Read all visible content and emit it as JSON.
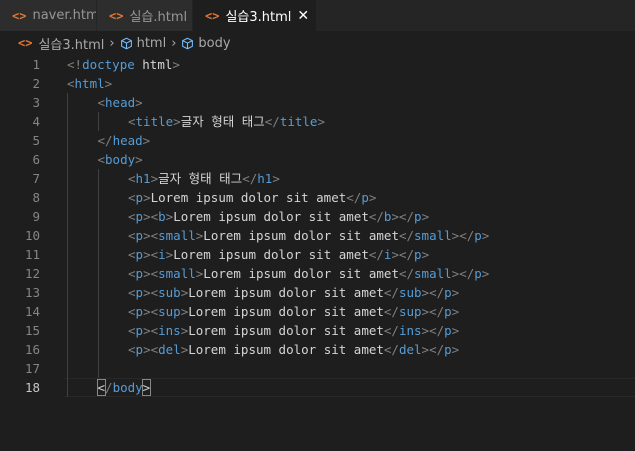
{
  "tabs": [
    {
      "icon": "<>",
      "label": "naver.html",
      "modified": true,
      "active": false
    },
    {
      "icon": "<>",
      "label": "실습.html",
      "modified": false,
      "active": false
    },
    {
      "icon": "<>",
      "label": "실습3.html",
      "modified": false,
      "active": true
    }
  ],
  "breadcrumb": {
    "file": "실습3.html",
    "items": [
      "html",
      "body"
    ]
  },
  "editor": {
    "current_line": 18,
    "lines": [
      {
        "n": "1",
        "indent": 0,
        "tokens": [
          [
            "p",
            "<!"
          ],
          [
            "t",
            "doctype"
          ],
          [
            "tx",
            " "
          ],
          [
            "tx",
            "html"
          ],
          [
            "p",
            ">"
          ]
        ]
      },
      {
        "n": "2",
        "indent": 0,
        "tokens": [
          [
            "p",
            "<"
          ],
          [
            "t",
            "html"
          ],
          [
            "p",
            ">"
          ]
        ]
      },
      {
        "n": "3",
        "indent": 1,
        "tokens": [
          [
            "p",
            "<"
          ],
          [
            "t",
            "head"
          ],
          [
            "p",
            ">"
          ]
        ]
      },
      {
        "n": "4",
        "indent": 2,
        "tokens": [
          [
            "p",
            "<"
          ],
          [
            "t",
            "title"
          ],
          [
            "p",
            ">"
          ],
          [
            "tx",
            "글자 형태 태그"
          ],
          [
            "p",
            "</"
          ],
          [
            "t",
            "title"
          ],
          [
            "p",
            ">"
          ]
        ]
      },
      {
        "n": "5",
        "indent": 1,
        "tokens": [
          [
            "p",
            "</"
          ],
          [
            "t",
            "head"
          ],
          [
            "p",
            ">"
          ]
        ]
      },
      {
        "n": "6",
        "indent": 1,
        "tokens": [
          [
            "p",
            "<"
          ],
          [
            "t",
            "body"
          ],
          [
            "p",
            ">"
          ]
        ]
      },
      {
        "n": "7",
        "indent": 2,
        "tokens": [
          [
            "p",
            "<"
          ],
          [
            "t",
            "h1"
          ],
          [
            "p",
            ">"
          ],
          [
            "tx",
            "글자 형태 태그"
          ],
          [
            "p",
            "</"
          ],
          [
            "t",
            "h1"
          ],
          [
            "p",
            ">"
          ]
        ]
      },
      {
        "n": "8",
        "indent": 2,
        "tokens": [
          [
            "p",
            "<"
          ],
          [
            "t",
            "p"
          ],
          [
            "p",
            ">"
          ],
          [
            "tx",
            "Lorem ipsum dolor sit amet"
          ],
          [
            "p",
            "</"
          ],
          [
            "t",
            "p"
          ],
          [
            "p",
            ">"
          ]
        ]
      },
      {
        "n": "9",
        "indent": 2,
        "tokens": [
          [
            "p",
            "<"
          ],
          [
            "t",
            "p"
          ],
          [
            "p",
            "><"
          ],
          [
            "t",
            "b"
          ],
          [
            "p",
            ">"
          ],
          [
            "tx",
            "Lorem ipsum dolor sit amet"
          ],
          [
            "p",
            "</"
          ],
          [
            "t",
            "b"
          ],
          [
            "p",
            "></"
          ],
          [
            "t",
            "p"
          ],
          [
            "p",
            ">"
          ]
        ]
      },
      {
        "n": "10",
        "indent": 2,
        "tokens": [
          [
            "p",
            "<"
          ],
          [
            "t",
            "p"
          ],
          [
            "p",
            "><"
          ],
          [
            "t",
            "small"
          ],
          [
            "p",
            ">"
          ],
          [
            "tx",
            "Lorem ipsum dolor sit amet"
          ],
          [
            "p",
            "</"
          ],
          [
            "t",
            "small"
          ],
          [
            "p",
            "></"
          ],
          [
            "t",
            "p"
          ],
          [
            "p",
            ">"
          ]
        ]
      },
      {
        "n": "11",
        "indent": 2,
        "tokens": [
          [
            "p",
            "<"
          ],
          [
            "t",
            "p"
          ],
          [
            "p",
            "><"
          ],
          [
            "t",
            "i"
          ],
          [
            "p",
            ">"
          ],
          [
            "tx",
            "Lorem ipsum dolor sit amet"
          ],
          [
            "p",
            "</"
          ],
          [
            "t",
            "i"
          ],
          [
            "p",
            "></"
          ],
          [
            "t",
            "p"
          ],
          [
            "p",
            ">"
          ]
        ]
      },
      {
        "n": "12",
        "indent": 2,
        "tokens": [
          [
            "p",
            "<"
          ],
          [
            "t",
            "p"
          ],
          [
            "p",
            "><"
          ],
          [
            "t",
            "small"
          ],
          [
            "p",
            ">"
          ],
          [
            "tx",
            "Lorem ipsum dolor sit amet"
          ],
          [
            "p",
            "</"
          ],
          [
            "t",
            "small"
          ],
          [
            "p",
            "></"
          ],
          [
            "t",
            "p"
          ],
          [
            "p",
            ">"
          ]
        ]
      },
      {
        "n": "13",
        "indent": 2,
        "tokens": [
          [
            "p",
            "<"
          ],
          [
            "t",
            "p"
          ],
          [
            "p",
            "><"
          ],
          [
            "t",
            "sub"
          ],
          [
            "p",
            ">"
          ],
          [
            "tx",
            "Lorem ipsum dolor sit amet"
          ],
          [
            "p",
            "</"
          ],
          [
            "t",
            "sub"
          ],
          [
            "p",
            "></"
          ],
          [
            "t",
            "p"
          ],
          [
            "p",
            ">"
          ]
        ]
      },
      {
        "n": "14",
        "indent": 2,
        "tokens": [
          [
            "p",
            "<"
          ],
          [
            "t",
            "p"
          ],
          [
            "p",
            "><"
          ],
          [
            "t",
            "sup"
          ],
          [
            "p",
            ">"
          ],
          [
            "tx",
            "Lorem ipsum dolor sit amet"
          ],
          [
            "p",
            "</"
          ],
          [
            "t",
            "sup"
          ],
          [
            "p",
            "></"
          ],
          [
            "t",
            "p"
          ],
          [
            "p",
            ">"
          ]
        ]
      },
      {
        "n": "15",
        "indent": 2,
        "tokens": [
          [
            "p",
            "<"
          ],
          [
            "t",
            "p"
          ],
          [
            "p",
            "><"
          ],
          [
            "t",
            "ins"
          ],
          [
            "p",
            ">"
          ],
          [
            "tx",
            "Lorem ipsum dolor sit amet"
          ],
          [
            "p",
            "</"
          ],
          [
            "t",
            "ins"
          ],
          [
            "p",
            "></"
          ],
          [
            "t",
            "p"
          ],
          [
            "p",
            ">"
          ]
        ]
      },
      {
        "n": "16",
        "indent": 2,
        "tokens": [
          [
            "p",
            "<"
          ],
          [
            "t",
            "p"
          ],
          [
            "p",
            "><"
          ],
          [
            "t",
            "del"
          ],
          [
            "p",
            ">"
          ],
          [
            "tx",
            "Lorem ipsum dolor sit amet"
          ],
          [
            "p",
            "</"
          ],
          [
            "t",
            "del"
          ],
          [
            "p",
            "></"
          ],
          [
            "t",
            "p"
          ],
          [
            "p",
            ">"
          ]
        ]
      },
      {
        "n": "17",
        "indent": 0,
        "tokens": []
      },
      {
        "n": "18",
        "indent": 1,
        "tokens": [
          [
            "bk",
            "<"
          ],
          [
            "p",
            "/"
          ],
          [
            "t",
            "body"
          ],
          [
            "bk",
            ">"
          ]
        ]
      }
    ]
  },
  "colors": {
    "tag": "#569cd6",
    "punct": "#808080",
    "text": "#d4d4d4",
    "file_icon": "#e37933",
    "cube_icon": "#75beff"
  }
}
